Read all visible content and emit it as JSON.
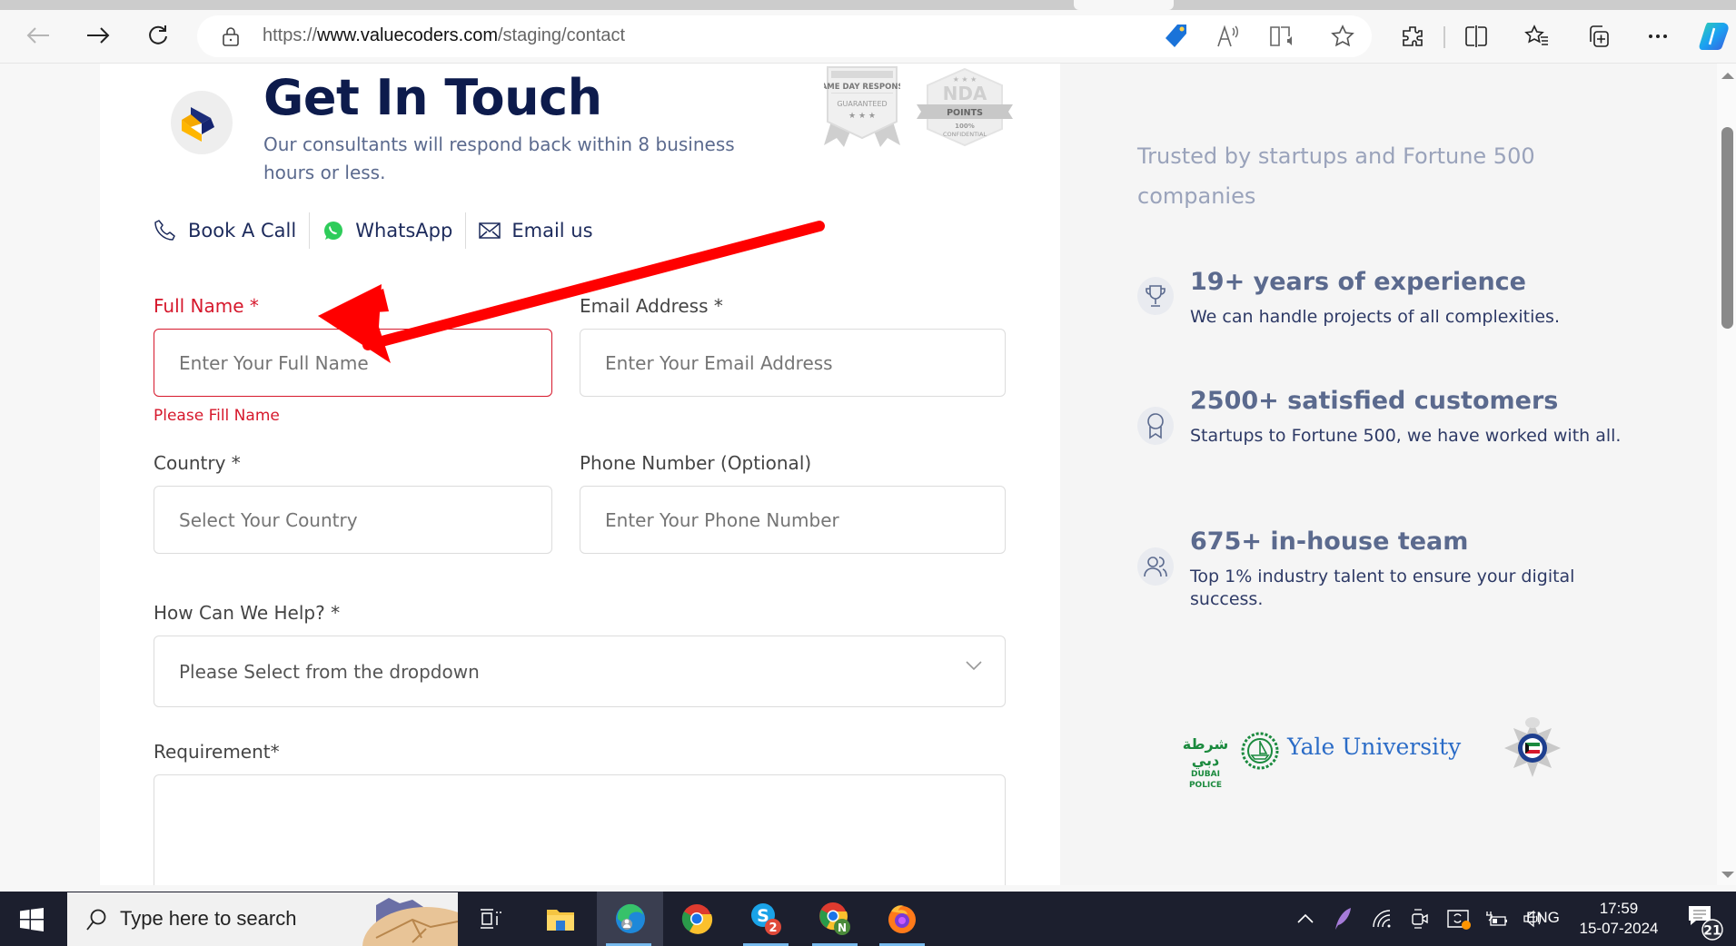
{
  "browser": {
    "url_prefix": "https://",
    "url_domain": "www.valuecoders.com",
    "url_path": "/staging/contact"
  },
  "header": {
    "title": "Get In Touch",
    "subtitle": "Our consultants will respond back within 8 business hours or less.",
    "badges": [
      {
        "line1": "SAME DAY RESPONSE",
        "line2": "GUARANTEED"
      },
      {
        "line1": "NDA",
        "line2": "POINTS",
        "line3": "100%",
        "line4": "CONFIDENTIAL"
      }
    ]
  },
  "contacts": [
    {
      "label": "Book A Call",
      "icon": "phone-icon"
    },
    {
      "label": "WhatsApp",
      "icon": "whatsapp-icon"
    },
    {
      "label": "Email us",
      "icon": "mail-icon"
    }
  ],
  "form": {
    "full_name": {
      "label": "Full Name *",
      "placeholder": "Enter Your Full Name",
      "value": "",
      "error": "Please Fill Name"
    },
    "email": {
      "label": "Email Address *",
      "placeholder": "Enter Your Email Address",
      "value": ""
    },
    "country": {
      "label": "Country *",
      "placeholder": "Select Your Country",
      "value": ""
    },
    "phone": {
      "label": "Phone Number (Optional)",
      "placeholder": "Enter Your Phone Number",
      "value": ""
    },
    "help": {
      "label": "How Can We Help? *",
      "selected": "Please Select from the dropdown"
    },
    "requirement": {
      "label": "Requirement*",
      "value": ""
    }
  },
  "colors": {
    "accent": "#0d1b4c",
    "error": "#d6182c",
    "annotation_arrow": "#ff0000"
  },
  "side": {
    "trusted": "Trusted by startups and Fortune 500 companies",
    "features": [
      {
        "icon": "trophy-icon",
        "title": "19+ years of experience",
        "desc": "We can handle projects of all complexities."
      },
      {
        "icon": "award-icon",
        "title": "2500+ satisfied customers",
        "desc": "Startups to Fortune 500, we have worked with all."
      },
      {
        "icon": "team-icon",
        "title": "675+ in-house team",
        "desc": "Top 1% industry talent to ensure your digital success."
      }
    ],
    "client_logos": {
      "dubai_ar": "شرطة دبي",
      "dubai_en": "DUBAI POLICE",
      "yale": "Yale University"
    }
  },
  "taskbar": {
    "search_placeholder": "Type here to search",
    "apps": [
      "task-view",
      "file-explorer",
      "edge",
      "chrome",
      "skype",
      "chrome-profile",
      "firefox"
    ],
    "skype_badge": "2",
    "chrome_profile_badge": "N",
    "language": "ENG",
    "time": "17:59",
    "date": "15-07-2024",
    "notifications": "21"
  }
}
